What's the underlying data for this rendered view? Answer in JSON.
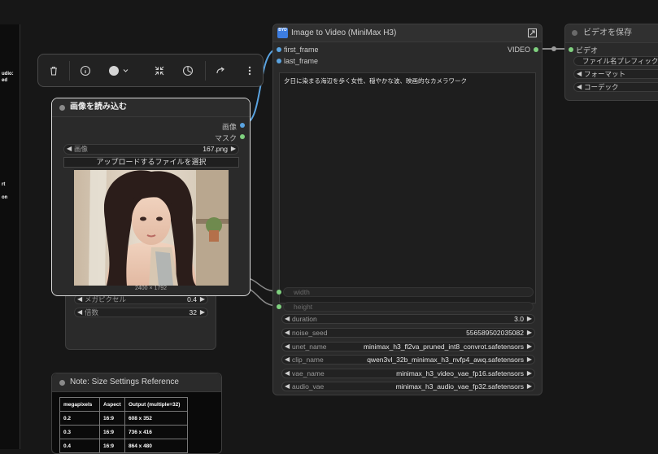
{
  "left_panel": {
    "lines": [
      "udio:",
      "ed",
      "rt",
      "on"
    ]
  },
  "toolbar": {
    "icons": [
      "trash-icon",
      "info-icon",
      "color-circle-icon",
      "collapse-icon",
      "bypass-icon",
      "redo-icon",
      "more-icon"
    ]
  },
  "load_image": {
    "title": "画像を読み込む",
    "outputs": [
      "画像",
      "マスク"
    ],
    "image_widget": {
      "label": "画像",
      "value": "167.png"
    },
    "upload_button": "アップロードするファイルを選択",
    "resolution": "2400 × 1792"
  },
  "scale_node": {
    "megapixels": {
      "label": "メガピクセル",
      "value": "0.4"
    },
    "multiple": {
      "label": "倍数",
      "value": "32"
    }
  },
  "note": {
    "title": "Note: Size Settings Reference",
    "headers": [
      "megapixels",
      "Aspect",
      "Output (multiple=32)"
    ],
    "rows": [
      [
        "0.2",
        "16:9",
        "608 x 352"
      ],
      [
        "0.3",
        "16:9",
        "736 x 416"
      ],
      [
        "0.4",
        "16:9",
        "864 x 480"
      ]
    ]
  },
  "i2v": {
    "badge": "BYD",
    "title": "Image to Video (MiniMax H3)",
    "inputs": [
      "first_frame",
      "last_frame"
    ],
    "output": "VIDEO",
    "prompt": "夕日に染まる海辺を歩く女性、穏やかな波、映画的なカメラワーク",
    "converted_inputs": [
      "width",
      "height"
    ],
    "widgets": [
      {
        "label": "duration",
        "value": "3.0"
      },
      {
        "label": "noise_seed",
        "value": "556589502035082"
      },
      {
        "label": "unet_name",
        "value": "minimax_h3_fl2va_pruned_int8_convrot.safetensors"
      },
      {
        "label": "clip_name",
        "value": "qwen3vl_32b_minimax_h3_nvfp4_awq.safetensors"
      },
      {
        "label": "vae_name",
        "value": "minimax_h3_video_vae_fp16.safetensors"
      },
      {
        "label": "audio_vae",
        "value": "minimax_h3_audio_vae_fp32.safetensors"
      }
    ]
  },
  "save_video": {
    "title": "ビデオを保存",
    "input": "ビデオ",
    "widgets": [
      "ファイル名プレフィックス",
      "フォーマット",
      "コーデック"
    ]
  },
  "colors": {
    "canvas": "#171717",
    "link_blue": "#5aa3e0",
    "link_green": "#7fd17f",
    "selected_border": "#d9d9d9"
  }
}
